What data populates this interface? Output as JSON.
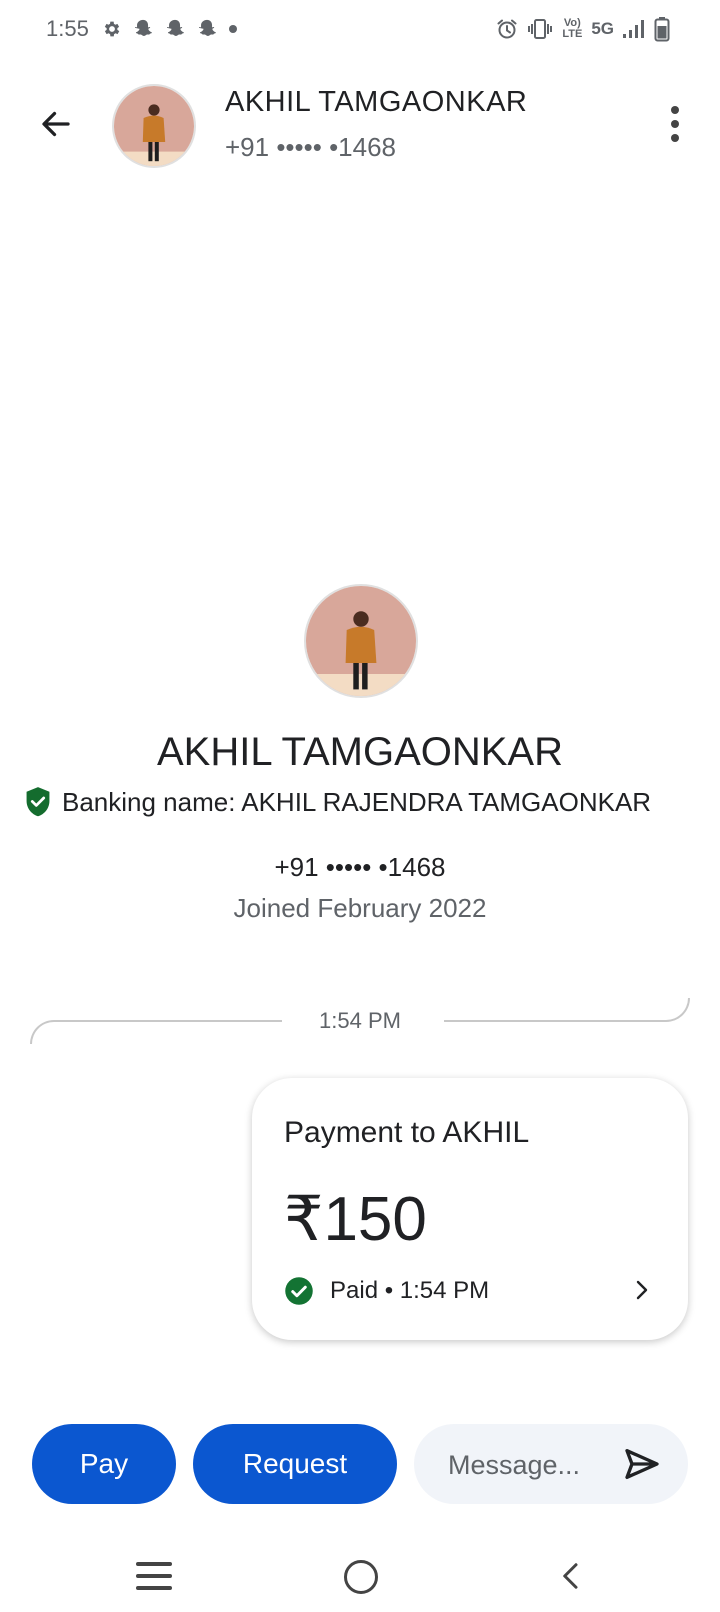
{
  "status_bar": {
    "time": "1:55",
    "left_icons": [
      "gear-icon",
      "snapchat-icon",
      "snapchat-icon",
      "snapchat-icon",
      "dot-icon"
    ],
    "right_icons": [
      "alarm-icon",
      "vibrate-icon",
      "volte-icon",
      "5g-icon",
      "signal-icon",
      "battery-icon"
    ],
    "volte_label": "Vo) LTE",
    "network": "5G"
  },
  "header": {
    "name": "AKHIL TAMGAONKAR",
    "phone": "+91 ••••• •1468"
  },
  "profile": {
    "name": "AKHIL TAMGAONKAR",
    "banking_name": "Banking name: AKHIL RAJENDRA TAMGAONKAR",
    "phone": "+91 ••••• •1468",
    "joined": "Joined February 2022"
  },
  "conversation": {
    "divider_time": "1:54 PM",
    "payment": {
      "title": "Payment to AKHIL",
      "amount": "₹150",
      "status": "Paid • 1:54 PM"
    }
  },
  "actions": {
    "pay_label": "Pay",
    "request_label": "Request",
    "message_placeholder": "Message..."
  },
  "colors": {
    "primary": "#0b57d0",
    "success": "#137333",
    "shield": "#146c2e"
  }
}
